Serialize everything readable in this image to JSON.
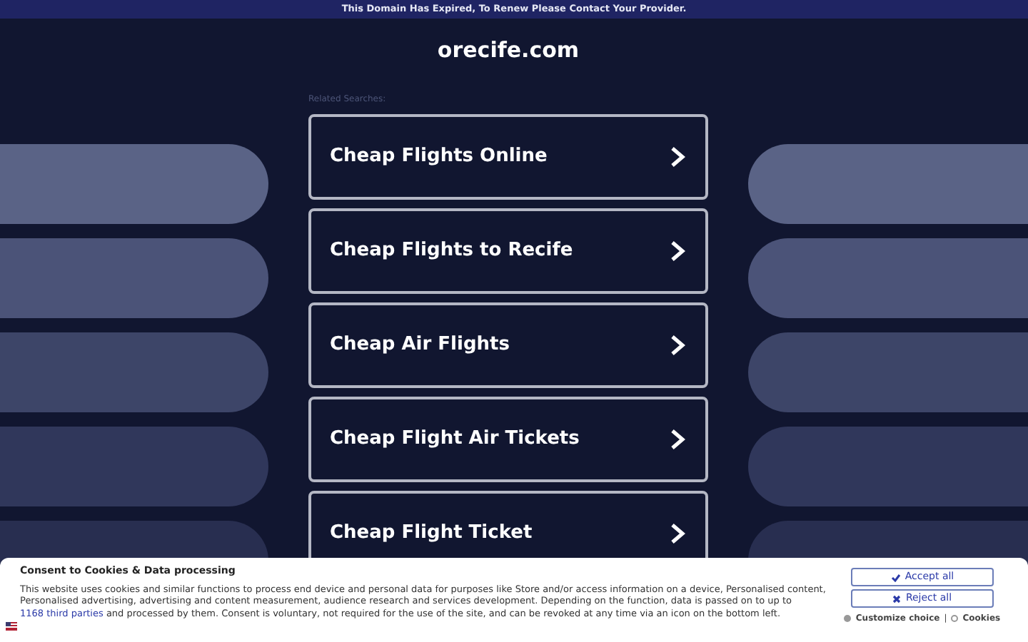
{
  "notice_bar": "This Domain Has Expired, To Renew Please Contact Your Provider.",
  "site_title": "orecife.com",
  "related_label": "Related Searches:",
  "links": [
    {
      "label": "Cheap Flights Online"
    },
    {
      "label": "Cheap Flights to Recife"
    },
    {
      "label": "Cheap Air Flights"
    },
    {
      "label": "Cheap Flight Air Tickets"
    },
    {
      "label": "Cheap Flight Ticket"
    }
  ],
  "consent": {
    "title": "Consent to Cookies & Data processing",
    "text_before": "This website uses cookies and similar functions to process end device and personal data for purposes like Store and/or access information on a device, Personalised content, Personalised advertising, advertising and content measurement, audience research and services development. Depending on the function, data is passed on to up to",
    "link": "1168 third parties",
    "text_after": "and processed by them. Consent is voluntary, not required for the use of the site, and can be revoked at any time via an icon on the bottom left.",
    "accept": "Accept all",
    "reject": "Reject all",
    "customize": "Customize choice",
    "separator": "|",
    "cookies": "Cookies"
  }
}
